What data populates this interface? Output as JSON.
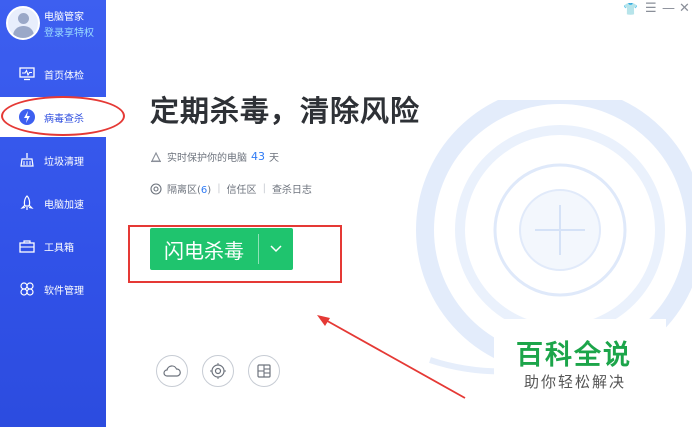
{
  "profile": {
    "name": "电脑管家",
    "login": "登录享特权"
  },
  "window_controls": {
    "skin": "👕",
    "menu": "☰",
    "minimize": "—",
    "close": "✕"
  },
  "sidebar": {
    "items": [
      {
        "label": "首页体检",
        "icon": "monitor-pulse-icon"
      },
      {
        "label": "病毒查杀",
        "icon": "lightning-shield-icon"
      },
      {
        "label": "垃圾清理",
        "icon": "trash-broom-icon"
      },
      {
        "label": "电脑加速",
        "icon": "rocket-icon"
      },
      {
        "label": "工具箱",
        "icon": "toolbox-icon"
      },
      {
        "label": "软件管理",
        "icon": "apps-icon"
      }
    ],
    "active_index": 1
  },
  "main": {
    "title": "定期杀毒，清除风险",
    "protect_prefix": "实时保护你的电脑",
    "protect_days": "43",
    "protect_suffix": "天",
    "quarantine_label": "隔离区",
    "quarantine_count": "6",
    "trust_label": "信任区",
    "log_label": "查杀日志",
    "scan_button": "闪电杀毒"
  },
  "bottom_icons": [
    "cloud-icon",
    "target-icon",
    "grid-window-icon"
  ],
  "watermark": {
    "title": "百科全说",
    "subtitle": "助你轻松解决"
  },
  "colors": {
    "sidebar": "#3152e8",
    "accent_green": "#1fc46e",
    "link_blue": "#2f7bf5",
    "annotation_red": "#e53935",
    "watermark_green": "#1ca54a"
  }
}
